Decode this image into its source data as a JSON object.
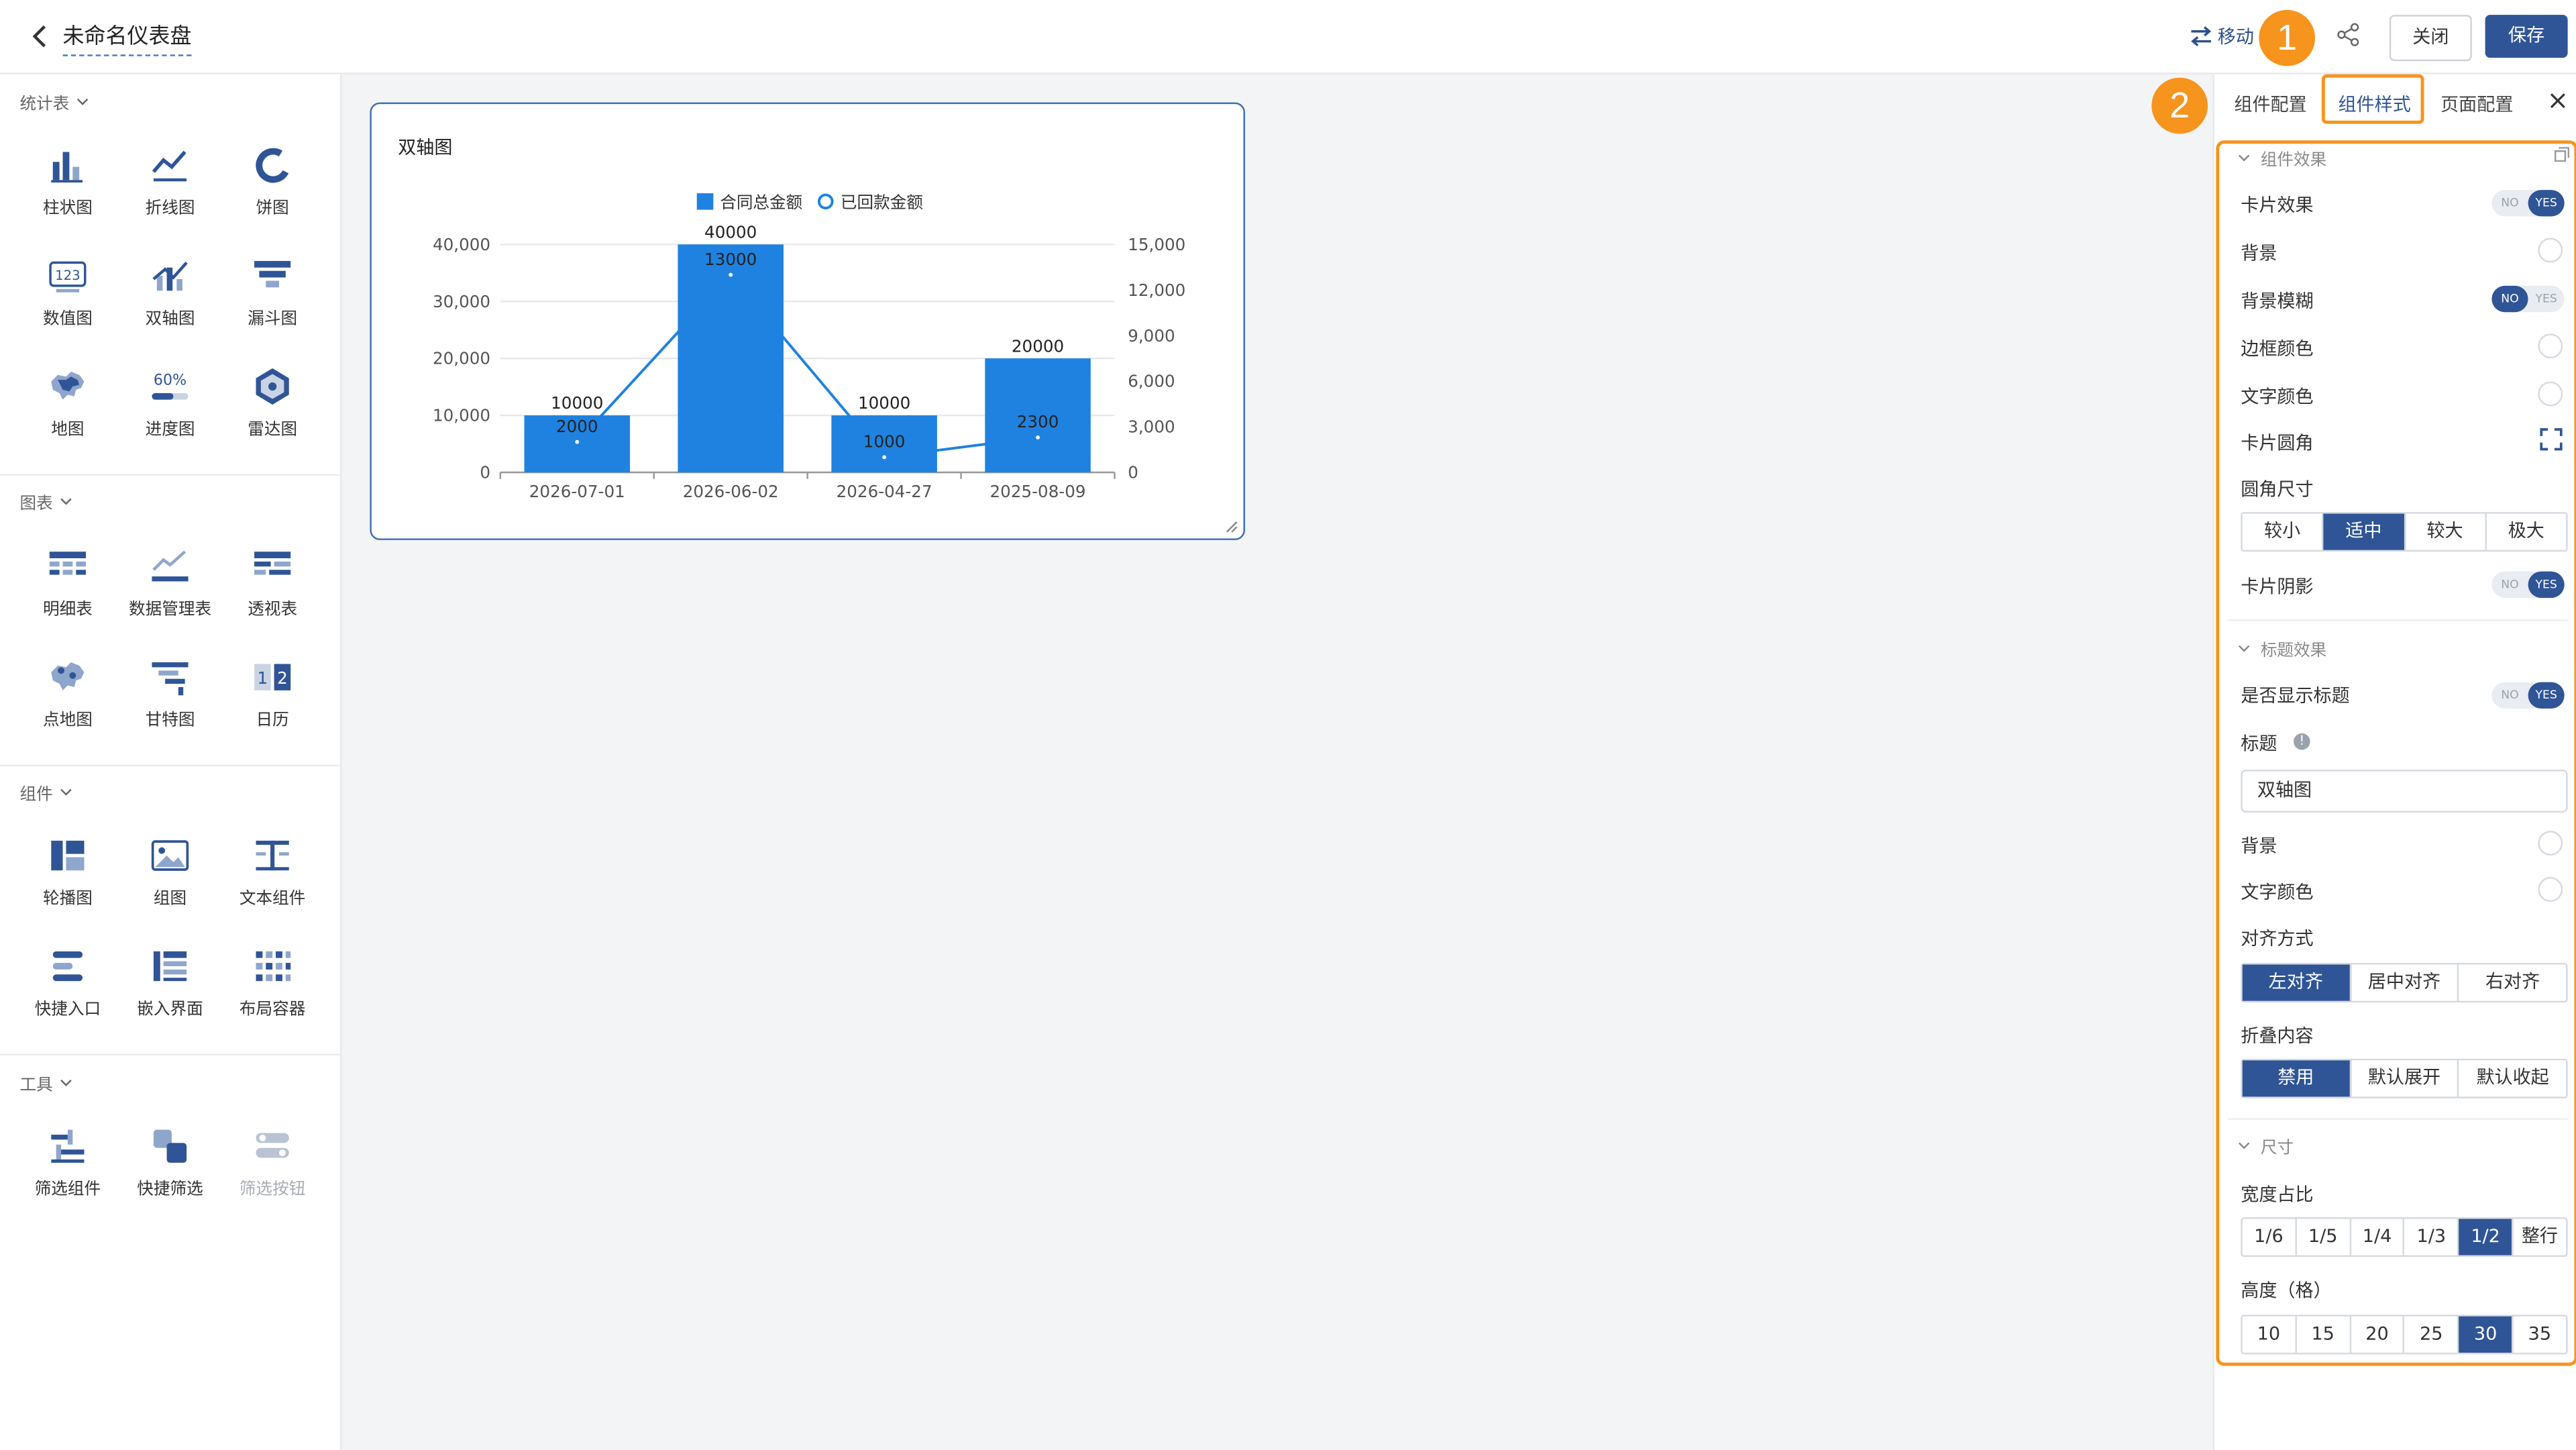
{
  "header": {
    "title": "未命名仪表盘",
    "move_label": "移动",
    "badge1": "1",
    "close_label": "关闭",
    "save_label": "保存"
  },
  "left_panel": {
    "sections": [
      {
        "title": "统计表",
        "items": [
          "柱状图",
          "折线图",
          "饼图",
          "数值图",
          "双轴图",
          "漏斗图",
          "地图",
          "进度图",
          "雷达图"
        ]
      },
      {
        "title": "图表",
        "items": [
          "明细表",
          "数据管理表",
          "透视表",
          "点地图",
          "甘特图",
          "日历"
        ]
      },
      {
        "title": "组件",
        "items": [
          "轮播图",
          "组图",
          "文本组件",
          "快捷入口",
          "嵌入界面",
          "布局容器"
        ]
      },
      {
        "title": "工具",
        "items": [
          "筛选组件",
          "快捷筛选",
          "筛选按钮"
        ]
      }
    ],
    "icon_text": {
      "number_chart": "123",
      "progress": "60%",
      "calendar_1": "1",
      "calendar_2": "2"
    }
  },
  "card": {
    "title": "双轴图"
  },
  "chart_data": {
    "type": "bar",
    "categories": [
      "2026-07-01",
      "2026-06-02",
      "2026-04-27",
      "2025-08-09"
    ],
    "series": [
      {
        "name": "合同总金额",
        "type": "bar",
        "axis": "left",
        "values": [
          10000,
          40000,
          10000,
          20000
        ],
        "color": "#1f82e0"
      },
      {
        "name": "已回款金额",
        "type": "line",
        "axis": "right",
        "values": [
          2000,
          13000,
          1000,
          2300
        ],
        "color": "#1f82e0"
      }
    ],
    "y_left": {
      "ticks": [
        0,
        10000,
        20000,
        30000,
        40000
      ],
      "tick_labels": [
        "0",
        "10,000",
        "20,000",
        "30,000",
        "40,000"
      ],
      "range": [
        0,
        40000
      ]
    },
    "y_right": {
      "ticks": [
        0,
        3000,
        6000,
        9000,
        12000,
        15000
      ],
      "tick_labels": [
        "0",
        "3,000",
        "6,000",
        "9,000",
        "12,000",
        "15,000"
      ],
      "range": [
        0,
        15000
      ]
    },
    "bar_labels": [
      "10000",
      "40000",
      "10000",
      "20000"
    ],
    "line_labels": [
      "2000",
      "13000",
      "1000",
      "2300"
    ],
    "legend_position": "top-center",
    "grid": true
  },
  "right_panel": {
    "tabs": [
      "组件配置",
      "组件样式",
      "页面配置"
    ],
    "badge2": "2",
    "groups": {
      "card_effect": "组件效果",
      "title_effect": "标题效果",
      "size": "尺寸"
    },
    "labels": {
      "card_effect": "卡片效果",
      "background": "背景",
      "bg_blur": "背景模糊",
      "border_color": "边框颜色",
      "text_color": "文字颜色",
      "card_radius": "卡片圆角",
      "radius_size": "圆角尺寸",
      "card_shadow": "卡片阴影",
      "show_title": "是否显示标题",
      "title": "标题",
      "title_bg": "背景",
      "title_text_color": "文字颜色",
      "align": "对齐方式",
      "collapse": "折叠内容",
      "width_ratio": "宽度占比",
      "height_grid": "高度（格）"
    },
    "toggle_no": "NO",
    "toggle_yes": "YES",
    "title_value": "双轴图",
    "radius_options": [
      "较小",
      "适中",
      "较大",
      "极大"
    ],
    "align_options": [
      "左对齐",
      "居中对齐",
      "右对齐"
    ],
    "collapse_options": [
      "禁用",
      "默认展开",
      "默认收起"
    ],
    "width_options": [
      "1/6",
      "1/5",
      "1/4",
      "1/3",
      "1/2",
      "整行"
    ],
    "height_options": [
      "10",
      "15",
      "20",
      "25",
      "30",
      "35"
    ],
    "selected": {
      "radius": "适中",
      "align": "左对齐",
      "collapse": "禁用",
      "width": "1/2",
      "height": "30"
    },
    "toggles": {
      "card_effect": true,
      "bg_blur": false,
      "card_shadow": true,
      "show_title": true
    }
  }
}
